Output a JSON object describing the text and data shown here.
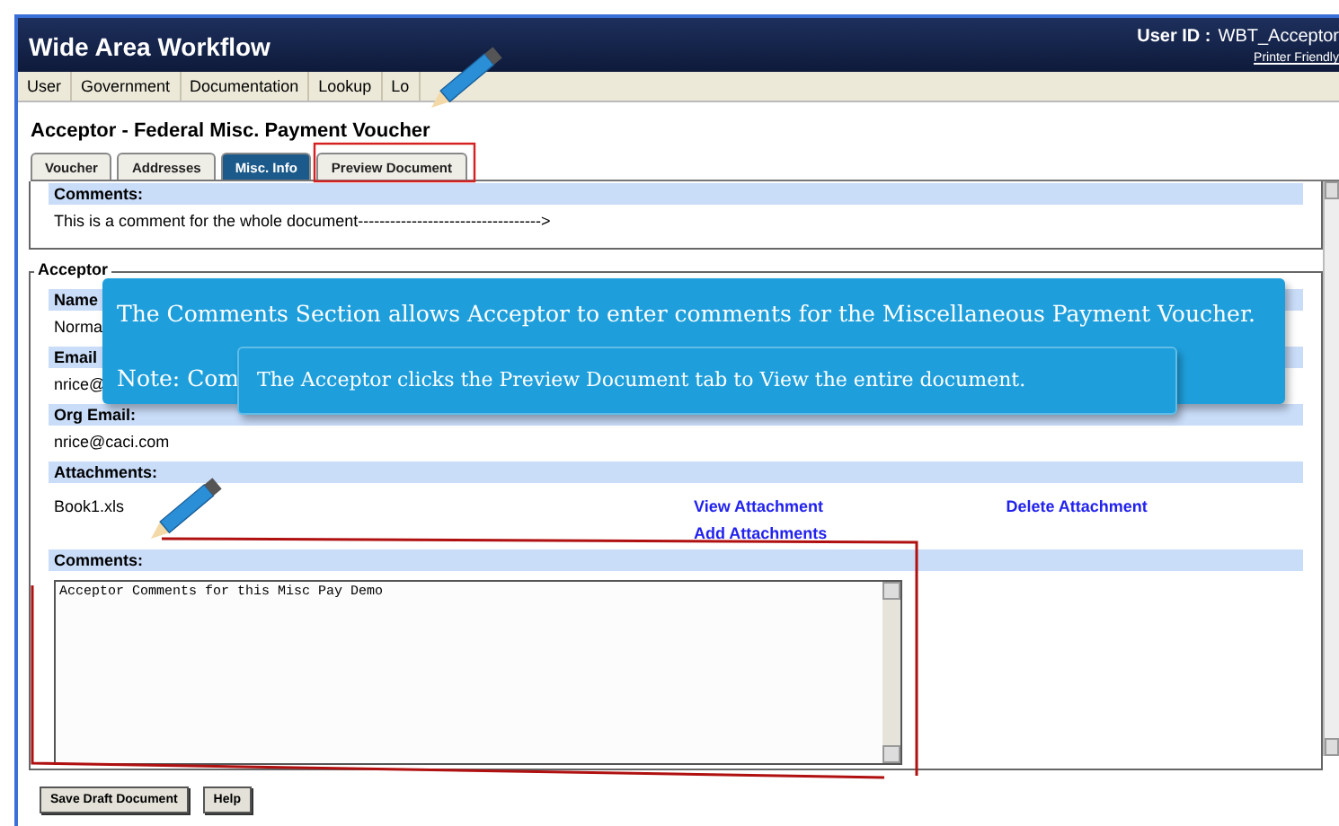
{
  "header": {
    "title": "Wide Area Workflow",
    "user_label": "User ID :",
    "user_id": "WBT_Acceptor",
    "printer_link": "Printer Friendly"
  },
  "menu": [
    "User",
    "Government",
    "Documentation",
    "Lookup",
    "Lo"
  ],
  "page_title": "Acceptor - Federal Misc. Payment Voucher",
  "tabs": [
    {
      "label": "Voucher",
      "selected": false
    },
    {
      "label": "Addresses",
      "selected": false
    },
    {
      "label": "Misc. Info",
      "selected": true
    },
    {
      "label": "Preview Document",
      "selected": false
    }
  ],
  "document_comments": {
    "label": "Comments:",
    "text": "This is a comment for the whole document---------------------------------->"
  },
  "acceptor": {
    "legend": "Acceptor",
    "fields": [
      {
        "label": "Name",
        "value": "Norma"
      },
      {
        "label": "Email",
        "value": "nrice@"
      },
      {
        "label": "Org Email:",
        "value": "nrice@caci.com"
      }
    ],
    "attachments": {
      "label": "Attachments:",
      "file": "Book1.xls",
      "links": [
        "View Attachment",
        "Delete Attachment",
        "Add Attachments"
      ]
    },
    "comments": {
      "label": "Comments:",
      "value": "Acceptor Comments for this Misc Pay Demo"
    }
  },
  "buttons": [
    "Save Draft Document",
    "Help"
  ],
  "callouts": [
    {
      "text": "The Comments Section allows Acceptor to enter comments for the Miscellaneous Payment Voucher.",
      "note": "Note: Com"
    },
    {
      "text": "The Acceptor clicks the Preview Document tab to View the entire document."
    }
  ]
}
